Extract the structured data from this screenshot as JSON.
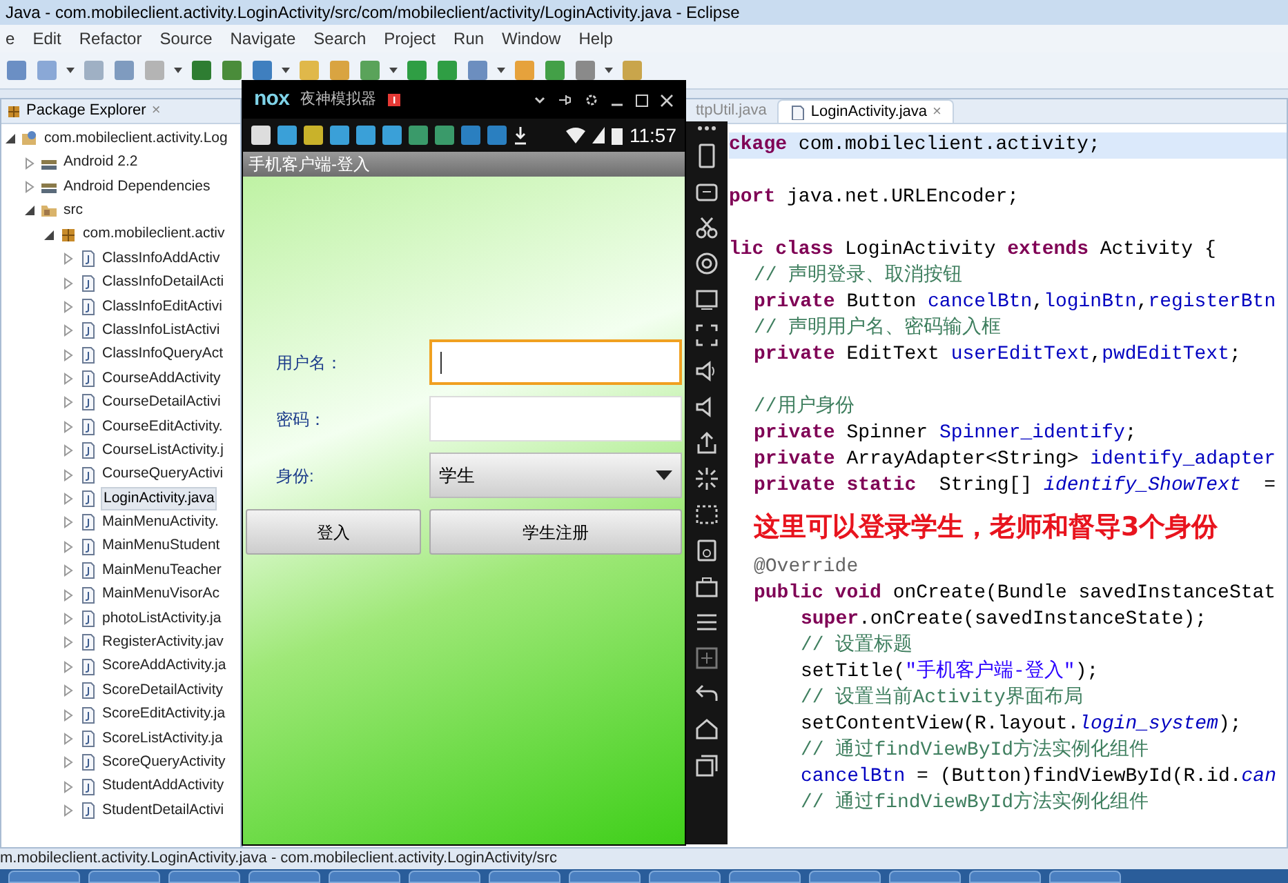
{
  "window": {
    "title": "Java - com.mobileclient.activity.LoginActivity/src/com/mobileclient/activity/LoginActivity.java - Eclipse"
  },
  "menu": [
    "e",
    "Edit",
    "Refactor",
    "Source",
    "Navigate",
    "Search",
    "Project",
    "Run",
    "Window",
    "Help"
  ],
  "explorer": {
    "title": "Package Explorer",
    "close": "×",
    "tree": [
      {
        "label": "com.mobileclient.activity.Log",
        "kind": "project",
        "expanded": true,
        "selected": false,
        "children": [
          {
            "label": "Android 2.2",
            "kind": "library",
            "expanded": false,
            "selected": false
          },
          {
            "label": "Android Dependencies",
            "kind": "library",
            "expanded": false,
            "selected": false
          },
          {
            "label": "src",
            "kind": "folder",
            "expanded": true,
            "selected": false,
            "children": [
              {
                "label": "com.mobileclient.activ",
                "kind": "package",
                "expanded": true,
                "selected": false,
                "children": [
                  {
                    "label": "ClassInfoAddActiv",
                    "kind": "file",
                    "expanded": false,
                    "selected": false
                  },
                  {
                    "label": "ClassInfoDetailActi",
                    "kind": "file",
                    "expanded": false,
                    "selected": false
                  },
                  {
                    "label": "ClassInfoEditActivi",
                    "kind": "file",
                    "expanded": false,
                    "selected": false
                  },
                  {
                    "label": "ClassInfoListActivi",
                    "kind": "file",
                    "expanded": false,
                    "selected": false
                  },
                  {
                    "label": "ClassInfoQueryAct",
                    "kind": "file",
                    "expanded": false,
                    "selected": false
                  },
                  {
                    "label": "CourseAddActivity",
                    "kind": "file",
                    "expanded": false,
                    "selected": false
                  },
                  {
                    "label": "CourseDetailActivi",
                    "kind": "file",
                    "expanded": false,
                    "selected": false
                  },
                  {
                    "label": "CourseEditActivity.",
                    "kind": "file",
                    "expanded": false,
                    "selected": false
                  },
                  {
                    "label": "CourseListActivity.j",
                    "kind": "file",
                    "expanded": false,
                    "selected": false
                  },
                  {
                    "label": "CourseQueryActivi",
                    "kind": "file",
                    "expanded": false,
                    "selected": false
                  },
                  {
                    "label": "LoginActivity.java",
                    "kind": "file",
                    "expanded": false,
                    "selected": true
                  },
                  {
                    "label": "MainMenuActivity.",
                    "kind": "file",
                    "expanded": false,
                    "selected": false
                  },
                  {
                    "label": "MainMenuStudent",
                    "kind": "file",
                    "expanded": false,
                    "selected": false
                  },
                  {
                    "label": "MainMenuTeacher",
                    "kind": "file",
                    "expanded": false,
                    "selected": false
                  },
                  {
                    "label": "MainMenuVisorAc",
                    "kind": "file",
                    "expanded": false,
                    "selected": false
                  },
                  {
                    "label": "photoListActivity.ja",
                    "kind": "file",
                    "expanded": false,
                    "selected": false
                  },
                  {
                    "label": "RegisterActivity.jav",
                    "kind": "file",
                    "expanded": false,
                    "selected": false
                  },
                  {
                    "label": "ScoreAddActivity.ja",
                    "kind": "file",
                    "expanded": false,
                    "selected": false
                  },
                  {
                    "label": "ScoreDetailActivity",
                    "kind": "file",
                    "expanded": false,
                    "selected": false
                  },
                  {
                    "label": "ScoreEditActivity.ja",
                    "kind": "file",
                    "expanded": false,
                    "selected": false
                  },
                  {
                    "label": "ScoreListActivity.ja",
                    "kind": "file",
                    "expanded": false,
                    "selected": false
                  },
                  {
                    "label": "ScoreQueryActivity",
                    "kind": "file",
                    "expanded": false,
                    "selected": false
                  },
                  {
                    "label": "StudentAddActivity",
                    "kind": "file",
                    "expanded": false,
                    "selected": false
                  },
                  {
                    "label": "StudentDetailActivi",
                    "kind": "file",
                    "expanded": false,
                    "selected": false
                  }
                ]
              }
            ]
          }
        ]
      }
    ]
  },
  "editor": {
    "tabs": [
      {
        "label": "ttpUtil.java",
        "selected": false
      },
      {
        "label": "LoginActivity.java",
        "selected": true,
        "close": "×"
      }
    ],
    "code_top": [
      {
        "kind": "top",
        "highlighted": true,
        "parts": [
          {
            "kind": "keyword",
            "text": "ckage"
          },
          {
            "kind": "plain",
            "text": " com.mobileclient.activity;"
          }
        ]
      },
      {
        "kind": "blank"
      },
      {
        "kind": "top",
        "highlighted": false,
        "parts": [
          {
            "kind": "keyword",
            "text": "port"
          },
          {
            "kind": "plain",
            "text": " java.net.URLEncoder;"
          }
        ]
      },
      {
        "kind": "blank"
      },
      {
        "kind": "top",
        "highlighted": false,
        "parts": [
          {
            "kind": "keyword",
            "text": "lic class"
          },
          {
            "kind": "plain",
            "text": " LoginActivity "
          },
          {
            "kind": "keyword",
            "text": "extends"
          },
          {
            "kind": "plain",
            "text": " Activity {"
          }
        ]
      },
      {
        "kind": "member",
        "highlighted": false,
        "parts": [
          {
            "kind": "comment",
            "text": "// 声明登录、取消按钮"
          }
        ]
      },
      {
        "kind": "member",
        "highlighted": false,
        "parts": [
          {
            "kind": "keyword",
            "text": "private"
          },
          {
            "kind": "plain",
            "text": " Button "
          },
          {
            "kind": "field",
            "text": "cancelBtn"
          },
          {
            "kind": "plain",
            "text": ","
          },
          {
            "kind": "field",
            "text": "loginBtn"
          },
          {
            "kind": "plain",
            "text": ","
          },
          {
            "kind": "field",
            "text": "registerBtn"
          }
        ]
      },
      {
        "kind": "member",
        "highlighted": false,
        "parts": [
          {
            "kind": "comment",
            "text": "// 声明用户名、密码输入框"
          }
        ]
      },
      {
        "kind": "member",
        "highlighted": false,
        "parts": [
          {
            "kind": "keyword",
            "text": "private"
          },
          {
            "kind": "plain",
            "text": " EditText "
          },
          {
            "kind": "field",
            "text": "userEditText"
          },
          {
            "kind": "plain",
            "text": ","
          },
          {
            "kind": "field",
            "text": "pwdEditText"
          },
          {
            "kind": "plain",
            "text": ";"
          }
        ]
      },
      {
        "kind": "blank"
      },
      {
        "kind": "member",
        "highlighted": false,
        "parts": [
          {
            "kind": "comment",
            "text": "//用户身份"
          }
        ]
      },
      {
        "kind": "member",
        "highlighted": false,
        "parts": [
          {
            "kind": "keyword",
            "text": "private"
          },
          {
            "kind": "plain",
            "text": " Spinner "
          },
          {
            "kind": "field",
            "text": "Spinner_identify"
          },
          {
            "kind": "plain",
            "text": ";"
          }
        ]
      },
      {
        "kind": "member",
        "highlighted": false,
        "parts": [
          {
            "kind": "keyword",
            "text": "private"
          },
          {
            "kind": "plain",
            "text": " ArrayAdapter<String> "
          },
          {
            "kind": "field",
            "text": "identify_adapter"
          }
        ]
      },
      {
        "kind": "member",
        "highlighted": false,
        "parts": [
          {
            "kind": "keyword",
            "text": "private static"
          },
          {
            "kind": "plain",
            "text": "  String[] "
          },
          {
            "kind": "static_field",
            "text": "identify_ShowText"
          },
          {
            "kind": "plain",
            "text": "  ="
          }
        ]
      }
    ],
    "note": "这里可以登录学生，老师和督导3个身份",
    "code_bottom": [
      {
        "kind": "member",
        "highlighted": false,
        "parts": [
          {
            "kind": "annotation",
            "text": "@Override"
          }
        ]
      },
      {
        "kind": "member",
        "highlighted": false,
        "parts": [
          {
            "kind": "keyword",
            "text": "public void"
          },
          {
            "kind": "plain",
            "text": " onCreate(Bundle savedInstanceStat"
          }
        ]
      },
      {
        "kind": "body",
        "highlighted": false,
        "parts": [
          {
            "kind": "keyword",
            "text": "super"
          },
          {
            "kind": "plain",
            "text": ".onCreate(savedInstanceState);"
          }
        ]
      },
      {
        "kind": "body",
        "highlighted": false,
        "parts": [
          {
            "kind": "comment",
            "text": "// 设置标题"
          }
        ]
      },
      {
        "kind": "body",
        "highlighted": false,
        "parts": [
          {
            "kind": "plain",
            "text": "setTitle("
          },
          {
            "kind": "string",
            "text": "\"手机客户端-登入\""
          },
          {
            "kind": "plain",
            "text": ");"
          }
        ]
      },
      {
        "kind": "body",
        "highlighted": false,
        "parts": [
          {
            "kind": "comment",
            "text": "// 设置当前Activity界面布局"
          }
        ]
      },
      {
        "kind": "body",
        "highlighted": false,
        "parts": [
          {
            "kind": "plain",
            "text": "setContentView(R.layout."
          },
          {
            "kind": "static_field",
            "text": "login_system"
          },
          {
            "kind": "plain",
            "text": ");"
          }
        ]
      },
      {
        "kind": "body",
        "highlighted": false,
        "parts": [
          {
            "kind": "comment",
            "text": "// 通过findViewById方法实例化组件"
          }
        ]
      },
      {
        "kind": "body",
        "highlighted": false,
        "parts": [
          {
            "kind": "field",
            "text": "cancelBtn"
          },
          {
            "kind": "plain",
            "text": " = (Button)findViewById(R.id."
          },
          {
            "kind": "static_field",
            "text": "can"
          }
        ]
      },
      {
        "kind": "body",
        "highlighted": false,
        "parts": [
          {
            "kind": "comment",
            "text": "// 通过findViewById方法实例化组件"
          }
        ]
      }
    ]
  },
  "status_bar": {
    "text": "m.mobileclient.activity.LoginActivity.java - com.mobileclient.activity.LoginActivity/src"
  },
  "emulator": {
    "logo": "nox",
    "title": "夜神模拟器",
    "time": "11:57",
    "app": {
      "title": "手机客户端-登入",
      "fields": [
        {
          "label": "用户名：",
          "focused": true
        },
        {
          "label": "密码：",
          "focused": false
        }
      ],
      "spinner": {
        "label": "身份:",
        "value": "学生"
      },
      "buttons": [
        "登入",
        "学生注册"
      ]
    }
  }
}
